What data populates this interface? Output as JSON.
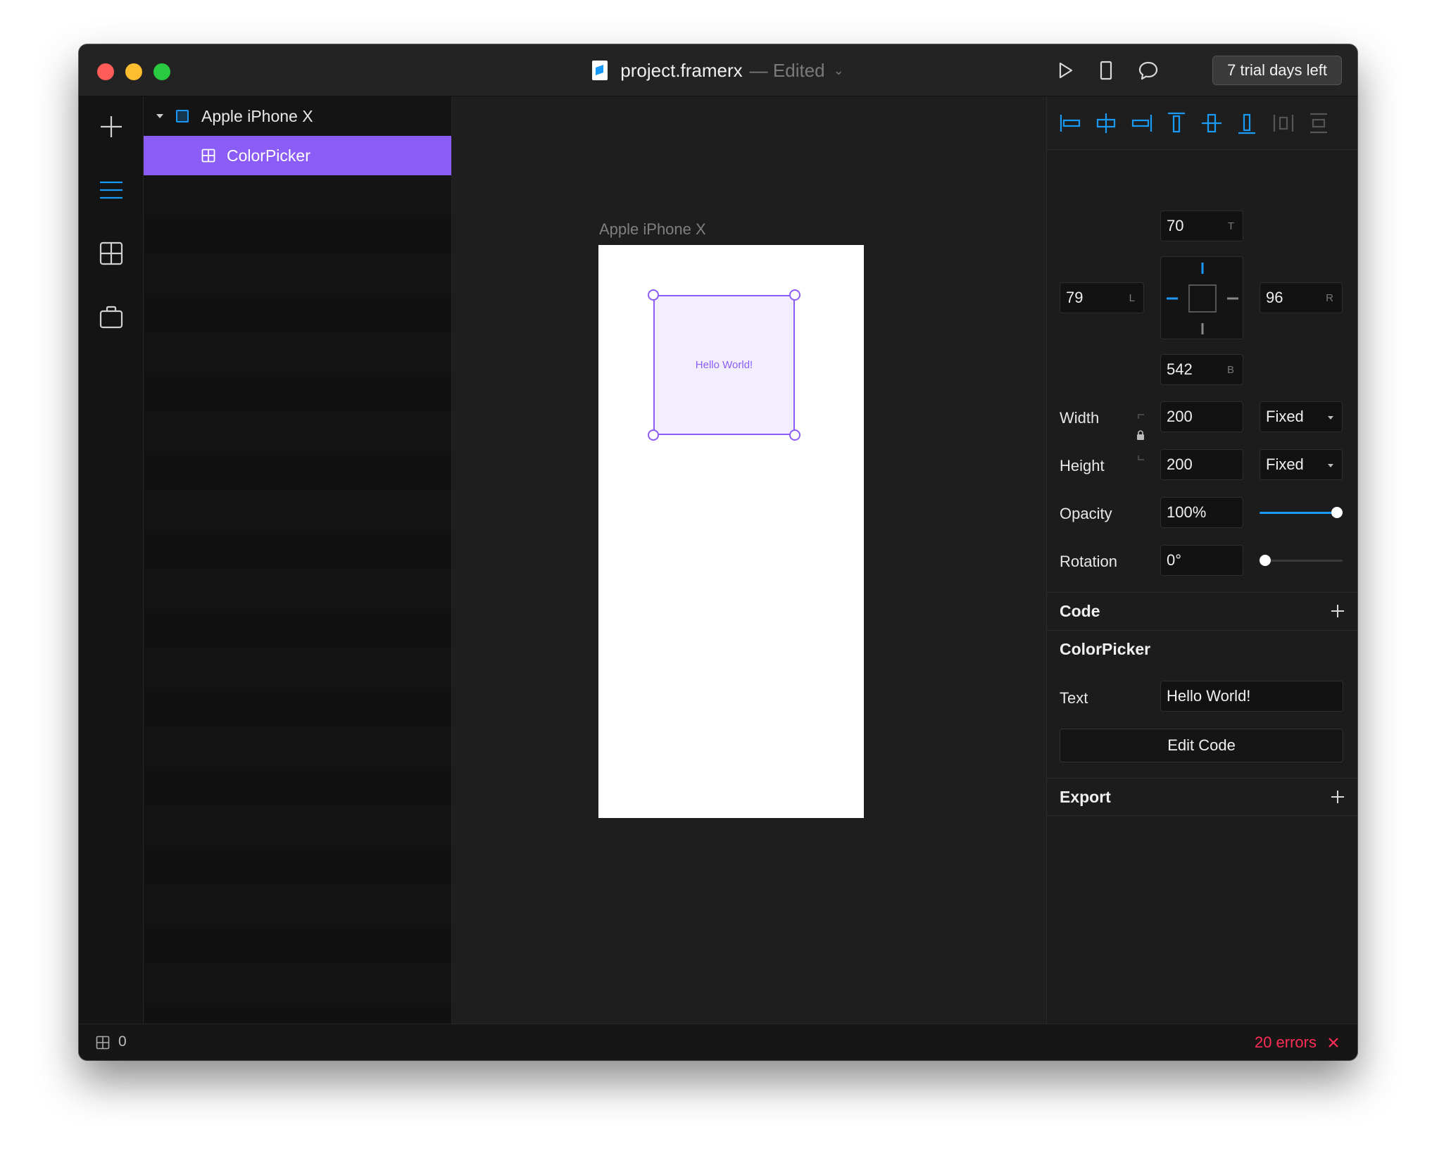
{
  "window": {
    "file_name": "project.framerx",
    "status": "— Edited",
    "trial_label": "7 trial days left"
  },
  "toolbar": {
    "icons": [
      "play-icon",
      "device-icon",
      "comment-icon"
    ]
  },
  "leftbar": {
    "icons": [
      "plus-icon",
      "layers-icon",
      "components-icon",
      "store-icon"
    ],
    "accent": "#1a9af7"
  },
  "layers": {
    "parent": "Apple iPhone X",
    "child": "ColorPicker",
    "selected_color": "#8b5cf6"
  },
  "canvas": {
    "artboard_label": "Apple iPhone X",
    "component_text": "Hello World!"
  },
  "props": {
    "top": "70",
    "top_suffix": "T",
    "left": "79",
    "left_suffix": "L",
    "right": "96",
    "right_suffix": "R",
    "bottom": "542",
    "bottom_suffix": "B",
    "width_label": "Width",
    "width": "200",
    "width_mode": "Fixed",
    "height_label": "Height",
    "height": "200",
    "height_mode": "Fixed",
    "opacity_label": "Opacity",
    "opacity": "100%",
    "opacity_level": 1.0,
    "rotation_label": "Rotation",
    "rotation": "0°",
    "rotation_level": 0.0,
    "code_section": "Code",
    "component_section": "ColorPicker",
    "text_label": "Text",
    "text_value": "Hello World!",
    "edit_code": "Edit Code",
    "export_section": "Export"
  },
  "statusbar": {
    "count": "0",
    "errors": "20 errors",
    "error_color": "#ff2d55"
  }
}
